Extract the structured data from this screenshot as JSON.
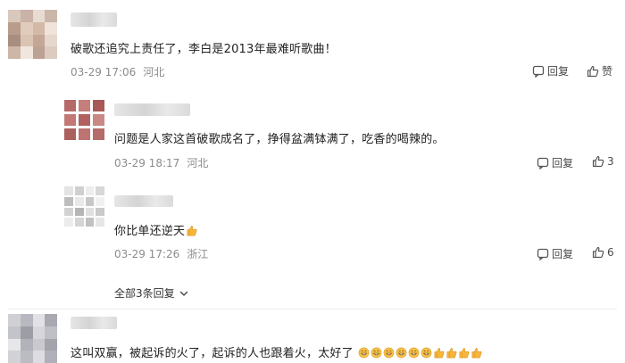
{
  "comments": [
    {
      "text": "破歌还追究上责任了，李白是2013年最难听歌曲！",
      "date": "03-29 17:06",
      "location": "河北",
      "reply_label": "回复",
      "like_label": "赞"
    }
  ],
  "replies": [
    {
      "text": "问题是人家这首破歌成名了，挣得盆满钵满了，吃香的喝辣的。",
      "date": "03-29 18:17",
      "location": "河北",
      "reply_label": "回复",
      "like_count": "3"
    },
    {
      "text": "你比单还逆天",
      "date": "03-29 17:26",
      "location": "浙江",
      "reply_label": "回复",
      "like_count": "6"
    }
  ],
  "expand_replies_label": "全部3条回复",
  "bottom_comment": {
    "text": "这叫双赢，被起诉的火了，起诉的人也跟着火，太好了"
  },
  "colors": {
    "meta_text": "#8c8c8c",
    "divider": "#ededed",
    "emoji_face": "#f6c14b",
    "emoji_thumb": "#f7b53d"
  },
  "icons": [
    "reply-icon",
    "thumb-up-icon",
    "chevron-down-icon",
    "emoji-grin-icon",
    "emoji-thumbs-up-icon"
  ]
}
